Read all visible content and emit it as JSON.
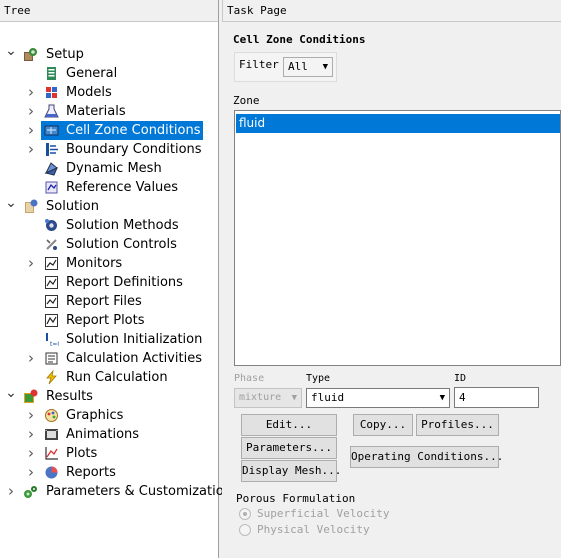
{
  "tree": {
    "header": "Tree",
    "items": [
      {
        "label": "Setup",
        "icon": "setup-icon",
        "arrow": "open",
        "level": 0
      },
      {
        "label": "General",
        "icon": "general-icon",
        "arrow": "none",
        "level": 1
      },
      {
        "label": "Models",
        "icon": "models-icon",
        "arrow": "closed",
        "level": 1
      },
      {
        "label": "Materials",
        "icon": "materials-icon",
        "arrow": "closed",
        "level": 1
      },
      {
        "label": "Cell Zone Conditions",
        "icon": "cell-zone-icon",
        "arrow": "closed",
        "level": 1,
        "selected": true
      },
      {
        "label": "Boundary Conditions",
        "icon": "boundary-icon",
        "arrow": "closed",
        "level": 1
      },
      {
        "label": "Dynamic Mesh",
        "icon": "dynamic-mesh-icon",
        "arrow": "none",
        "level": 1
      },
      {
        "label": "Reference Values",
        "icon": "reference-values-icon",
        "arrow": "none",
        "level": 1
      },
      {
        "label": "Solution",
        "icon": "solution-icon",
        "arrow": "open",
        "level": 0
      },
      {
        "label": "Solution Methods",
        "icon": "solution-methods-icon",
        "arrow": "none",
        "level": 1
      },
      {
        "label": "Solution Controls",
        "icon": "solution-controls-icon",
        "arrow": "none",
        "level": 1
      },
      {
        "label": "Monitors",
        "icon": "monitors-icon",
        "arrow": "closed",
        "level": 1
      },
      {
        "label": "Report Definitions",
        "icon": "report-definitions-icon",
        "arrow": "none",
        "level": 1
      },
      {
        "label": "Report Files",
        "icon": "report-files-icon",
        "arrow": "none",
        "level": 1
      },
      {
        "label": "Report Plots",
        "icon": "report-plots-icon",
        "arrow": "none",
        "level": 1
      },
      {
        "label": "Solution Initialization",
        "icon": "initialization-icon",
        "arrow": "none",
        "level": 1
      },
      {
        "label": "Calculation Activities",
        "icon": "calculation-activities-icon",
        "arrow": "closed",
        "level": 1
      },
      {
        "label": "Run Calculation",
        "icon": "run-calculation-icon",
        "arrow": "none",
        "level": 1
      },
      {
        "label": "Results",
        "icon": "results-icon",
        "arrow": "open",
        "level": 0
      },
      {
        "label": "Graphics",
        "icon": "graphics-icon",
        "arrow": "closed",
        "level": 1
      },
      {
        "label": "Animations",
        "icon": "animations-icon",
        "arrow": "closed",
        "level": 1
      },
      {
        "label": "Plots",
        "icon": "plots-icon",
        "arrow": "closed",
        "level": 1
      },
      {
        "label": "Reports",
        "icon": "reports-icon",
        "arrow": "closed",
        "level": 1
      },
      {
        "label": "Parameters & Customization",
        "icon": "parameters-icon",
        "arrow": "closed",
        "level": 0
      }
    ]
  },
  "task": {
    "header": "Task Page",
    "title": "Cell Zone Conditions",
    "filter_label": "Filter",
    "filter_value": "All",
    "zone_label": "Zone",
    "zones": [
      "fluid"
    ],
    "phase_label": "Phase",
    "phase_value": "mixture",
    "type_label": "Type",
    "type_value": "fluid",
    "id_label": "ID",
    "id_value": "4",
    "buttons": {
      "edit": "Edit...",
      "copy": "Copy...",
      "profiles": "Profiles...",
      "parameters": "Parameters...",
      "display_mesh": "Display Mesh...",
      "operating_conditions": "Operating Conditions..."
    },
    "porous_title": "Porous Formulation",
    "porous_options": [
      "Superficial Velocity",
      "Physical Velocity"
    ],
    "porous_selected": "Superficial Velocity"
  },
  "colors": {
    "selection": "#0078d7",
    "panel_bg": "#f0f0f0"
  }
}
